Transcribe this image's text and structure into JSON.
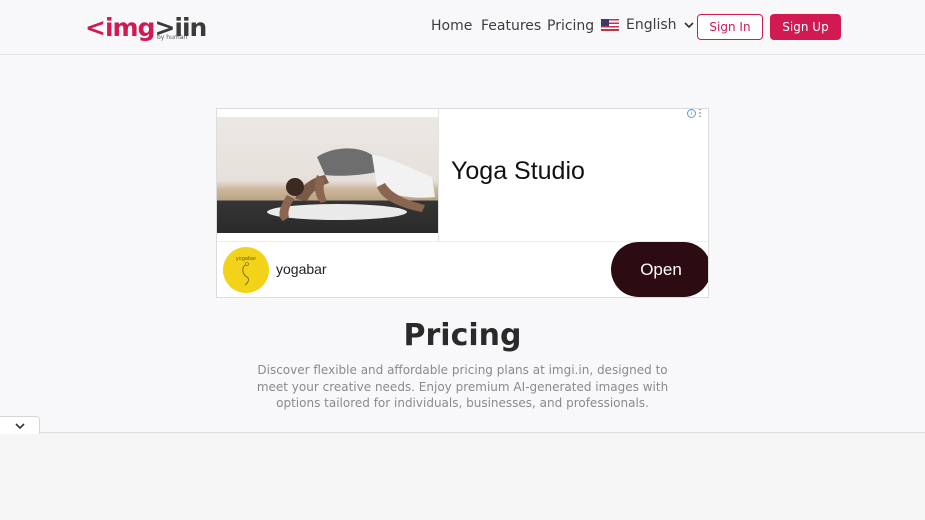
{
  "brand": {
    "logo_left": "<img",
    "logo_right": ">iin",
    "logo_sub": "by human"
  },
  "nav": {
    "links": [
      {
        "label": "Home"
      },
      {
        "label": "Features"
      },
      {
        "label": "Pricing"
      }
    ],
    "language": {
      "label": "English",
      "flag_icon": "us-flag-icon",
      "chevron_icon": "chevron-down-icon"
    },
    "sign_in": "Sign In",
    "sign_up": "Sign Up"
  },
  "ad": {
    "headline": "Yoga Studio",
    "advertiser": "yogabar",
    "cta": "Open",
    "avatar_text": "yogabar",
    "info_icon": "info-icon",
    "more_icon": "more-vertical-icon"
  },
  "pricing": {
    "title": "Pricing",
    "description": "Discover flexible and affordable pricing plans at imgi.in, designed to meet your creative needs. Enjoy premium AI-generated images with options tailored for individuals, businesses, and professionals."
  },
  "footer_toggle": {
    "icon": "chevron-down-icon"
  },
  "colors": {
    "accent": "#d11a52",
    "cta_dark": "#2c0c12",
    "avatar_yellow": "#f3d21a"
  }
}
